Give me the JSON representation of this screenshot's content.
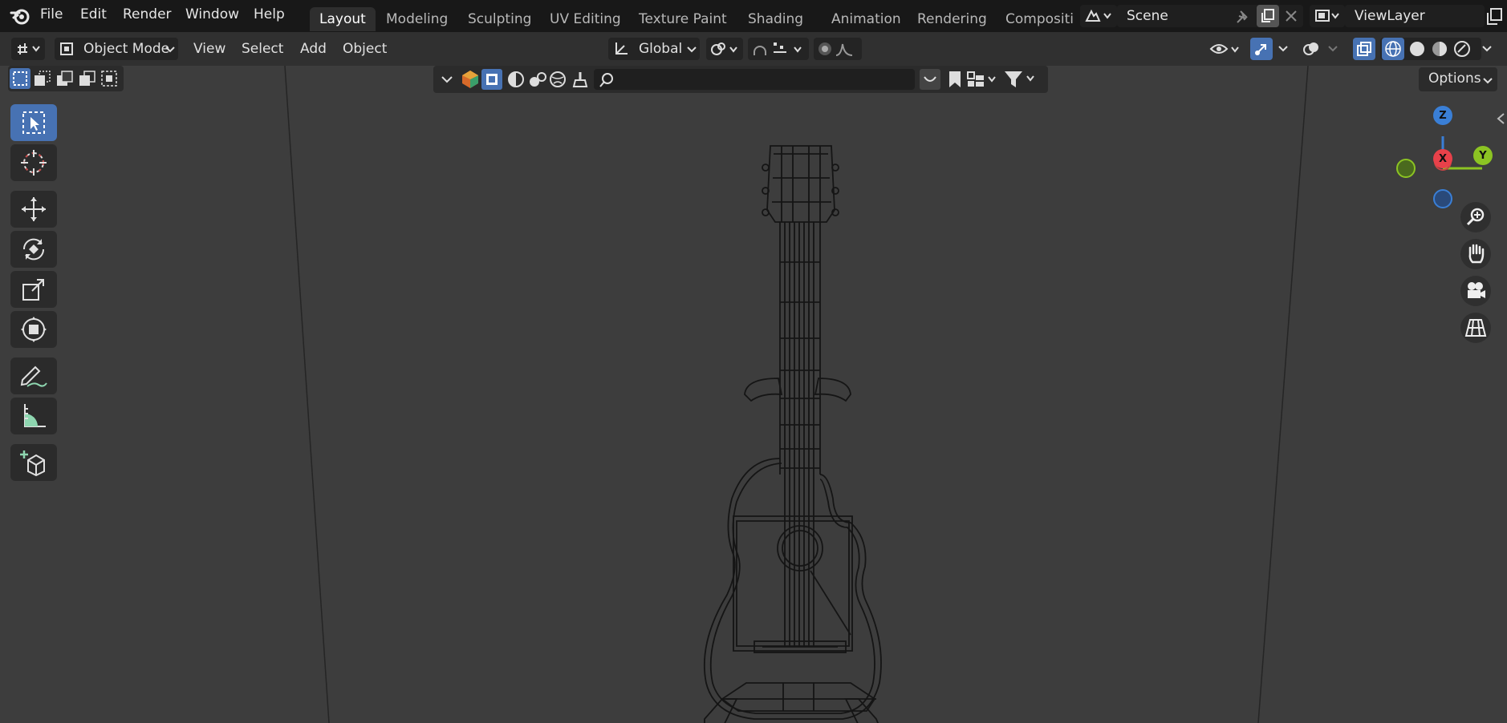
{
  "menubar": {
    "items": [
      "File",
      "Edit",
      "Render",
      "Window",
      "Help"
    ],
    "workspaces": [
      "Layout",
      "Modeling",
      "Sculpting",
      "UV Editing",
      "Texture Paint",
      "Shading",
      "Animation",
      "Rendering",
      "Compositin"
    ],
    "active_workspace": "Layout",
    "scene": "Scene",
    "view_layer": "ViewLayer"
  },
  "header": {
    "mode": "Object Mode",
    "menus": [
      "View",
      "Select",
      "Add",
      "Object"
    ],
    "orientation": "Global",
    "options": "Options"
  },
  "gizmo": {
    "z": "Z",
    "y": "Y",
    "x": "X"
  },
  "colors": {
    "accent_blue": "#4772b3",
    "axis_x": "#e8414a",
    "axis_y": "#8cc423",
    "axis_z": "#3a7fd6"
  }
}
